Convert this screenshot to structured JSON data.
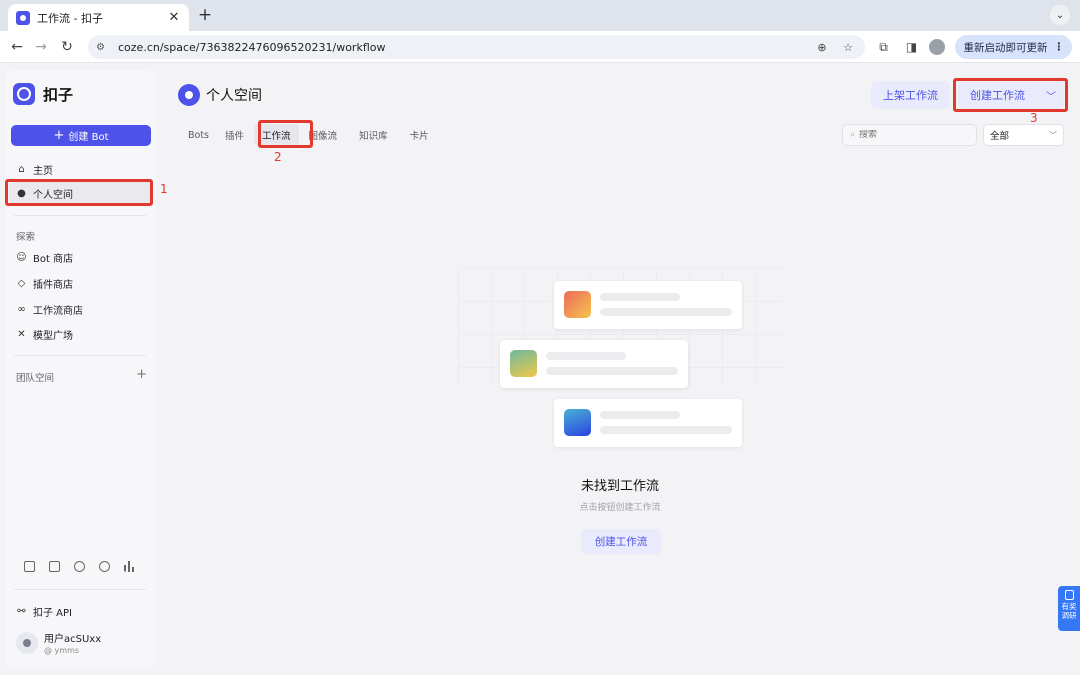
{
  "browser": {
    "tab_title": "工作流 - 扣子",
    "url": "coze.cn/space/7363822476096520231/workflow",
    "update_button": "重新启动即可更新"
  },
  "sidebar": {
    "brand": "扣子",
    "create_bot": "创建 Bot",
    "nav": [
      {
        "label": "主页",
        "icon": "home-icon"
      },
      {
        "label": "个人空间",
        "icon": "user-icon"
      }
    ],
    "explore_title": "探索",
    "explore": [
      {
        "label": "Bot 商店",
        "icon": "bot-icon"
      },
      {
        "label": "插件商店",
        "icon": "cube-icon"
      },
      {
        "label": "工作流商店",
        "icon": "workflow-icon"
      },
      {
        "label": "模型广场",
        "icon": "model-icon"
      }
    ],
    "team_title": "团队空间",
    "api": "扣子 API",
    "user": {
      "name": "用户acSUxx",
      "id": "@ ymms"
    }
  },
  "header": {
    "title": "个人空间",
    "publish_button": "上架工作流",
    "create_button": "创建工作流"
  },
  "tabs": [
    "Bots",
    "插件",
    "工作流",
    "图像流",
    "知识库",
    "卡片"
  ],
  "active_tab": "工作流",
  "filter": {
    "search_placeholder": "搜索",
    "select_value": "全部"
  },
  "annotations": [
    "1",
    "2",
    "3"
  ],
  "empty_state": {
    "title": "未找到工作流",
    "subtitle": "点击按钮创建工作流",
    "button": "创建工作流"
  },
  "survey": {
    "line1": "有奖",
    "line2": "调研"
  }
}
